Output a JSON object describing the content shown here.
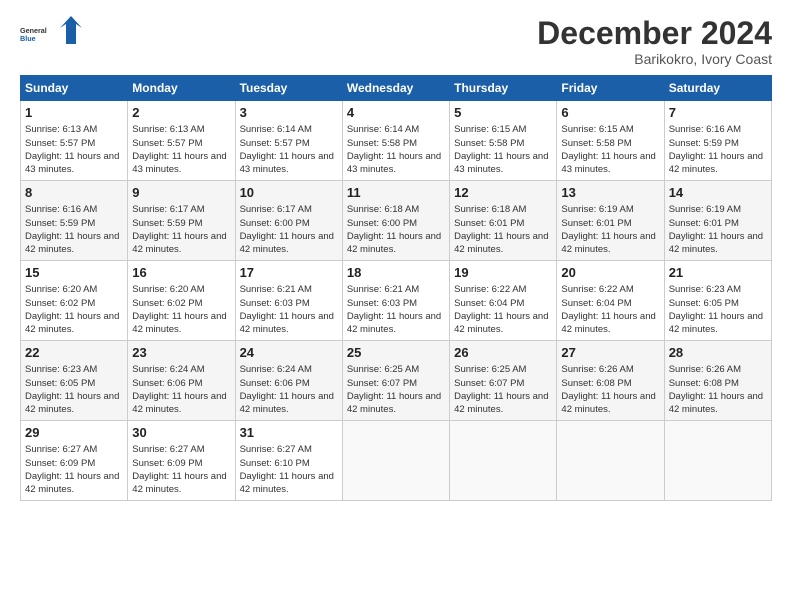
{
  "logo": {
    "line1": "General",
    "line2": "Blue"
  },
  "title": "December 2024",
  "subtitle": "Barikokro, Ivory Coast",
  "days_header": [
    "Sunday",
    "Monday",
    "Tuesday",
    "Wednesday",
    "Thursday",
    "Friday",
    "Saturday"
  ],
  "weeks": [
    [
      {
        "day": "1",
        "sunrise": "6:13 AM",
        "sunset": "5:57 PM",
        "daylight": "11 hours and 43 minutes."
      },
      {
        "day": "2",
        "sunrise": "6:13 AM",
        "sunset": "5:57 PM",
        "daylight": "11 hours and 43 minutes."
      },
      {
        "day": "3",
        "sunrise": "6:14 AM",
        "sunset": "5:57 PM",
        "daylight": "11 hours and 43 minutes."
      },
      {
        "day": "4",
        "sunrise": "6:14 AM",
        "sunset": "5:58 PM",
        "daylight": "11 hours and 43 minutes."
      },
      {
        "day": "5",
        "sunrise": "6:15 AM",
        "sunset": "5:58 PM",
        "daylight": "11 hours and 43 minutes."
      },
      {
        "day": "6",
        "sunrise": "6:15 AM",
        "sunset": "5:58 PM",
        "daylight": "11 hours and 43 minutes."
      },
      {
        "day": "7",
        "sunrise": "6:16 AM",
        "sunset": "5:59 PM",
        "daylight": "11 hours and 42 minutes."
      }
    ],
    [
      {
        "day": "8",
        "sunrise": "6:16 AM",
        "sunset": "5:59 PM",
        "daylight": "11 hours and 42 minutes."
      },
      {
        "day": "9",
        "sunrise": "6:17 AM",
        "sunset": "5:59 PM",
        "daylight": "11 hours and 42 minutes."
      },
      {
        "day": "10",
        "sunrise": "6:17 AM",
        "sunset": "6:00 PM",
        "daylight": "11 hours and 42 minutes."
      },
      {
        "day": "11",
        "sunrise": "6:18 AM",
        "sunset": "6:00 PM",
        "daylight": "11 hours and 42 minutes."
      },
      {
        "day": "12",
        "sunrise": "6:18 AM",
        "sunset": "6:01 PM",
        "daylight": "11 hours and 42 minutes."
      },
      {
        "day": "13",
        "sunrise": "6:19 AM",
        "sunset": "6:01 PM",
        "daylight": "11 hours and 42 minutes."
      },
      {
        "day": "14",
        "sunrise": "6:19 AM",
        "sunset": "6:01 PM",
        "daylight": "11 hours and 42 minutes."
      }
    ],
    [
      {
        "day": "15",
        "sunrise": "6:20 AM",
        "sunset": "6:02 PM",
        "daylight": "11 hours and 42 minutes."
      },
      {
        "day": "16",
        "sunrise": "6:20 AM",
        "sunset": "6:02 PM",
        "daylight": "11 hours and 42 minutes."
      },
      {
        "day": "17",
        "sunrise": "6:21 AM",
        "sunset": "6:03 PM",
        "daylight": "11 hours and 42 minutes."
      },
      {
        "day": "18",
        "sunrise": "6:21 AM",
        "sunset": "6:03 PM",
        "daylight": "11 hours and 42 minutes."
      },
      {
        "day": "19",
        "sunrise": "6:22 AM",
        "sunset": "6:04 PM",
        "daylight": "11 hours and 42 minutes."
      },
      {
        "day": "20",
        "sunrise": "6:22 AM",
        "sunset": "6:04 PM",
        "daylight": "11 hours and 42 minutes."
      },
      {
        "day": "21",
        "sunrise": "6:23 AM",
        "sunset": "6:05 PM",
        "daylight": "11 hours and 42 minutes."
      }
    ],
    [
      {
        "day": "22",
        "sunrise": "6:23 AM",
        "sunset": "6:05 PM",
        "daylight": "11 hours and 42 minutes."
      },
      {
        "day": "23",
        "sunrise": "6:24 AM",
        "sunset": "6:06 PM",
        "daylight": "11 hours and 42 minutes."
      },
      {
        "day": "24",
        "sunrise": "6:24 AM",
        "sunset": "6:06 PM",
        "daylight": "11 hours and 42 minutes."
      },
      {
        "day": "25",
        "sunrise": "6:25 AM",
        "sunset": "6:07 PM",
        "daylight": "11 hours and 42 minutes."
      },
      {
        "day": "26",
        "sunrise": "6:25 AM",
        "sunset": "6:07 PM",
        "daylight": "11 hours and 42 minutes."
      },
      {
        "day": "27",
        "sunrise": "6:26 AM",
        "sunset": "6:08 PM",
        "daylight": "11 hours and 42 minutes."
      },
      {
        "day": "28",
        "sunrise": "6:26 AM",
        "sunset": "6:08 PM",
        "daylight": "11 hours and 42 minutes."
      }
    ],
    [
      {
        "day": "29",
        "sunrise": "6:27 AM",
        "sunset": "6:09 PM",
        "daylight": "11 hours and 42 minutes."
      },
      {
        "day": "30",
        "sunrise": "6:27 AM",
        "sunset": "6:09 PM",
        "daylight": "11 hours and 42 minutes."
      },
      {
        "day": "31",
        "sunrise": "6:27 AM",
        "sunset": "6:10 PM",
        "daylight": "11 hours and 42 minutes."
      },
      null,
      null,
      null,
      null
    ]
  ],
  "label_sunrise": "Sunrise:",
  "label_sunset": "Sunset:",
  "label_daylight": "Daylight:"
}
